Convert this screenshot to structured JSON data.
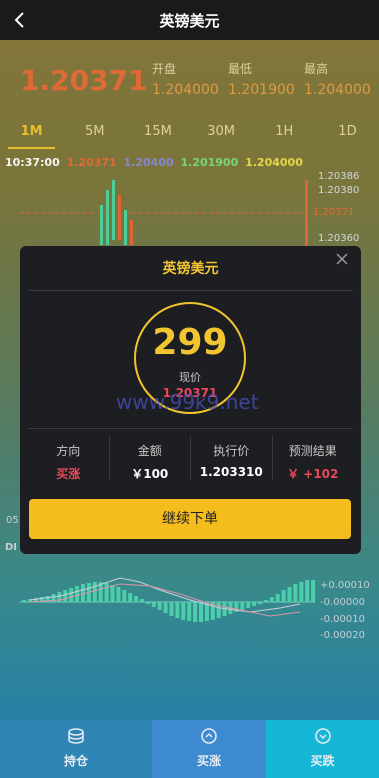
{
  "header": {
    "title": "英镑美元"
  },
  "quote": {
    "price": "1.20371",
    "stats": [
      {
        "label": "开盘",
        "value": "1.204000"
      },
      {
        "label": "最低",
        "value": "1.201900"
      },
      {
        "label": "最高",
        "value": "1.204000"
      }
    ]
  },
  "timeframes": [
    "1M",
    "5M",
    "15M",
    "30M",
    "1H",
    "1D"
  ],
  "active_timeframe": "1M",
  "ohlc_line": {
    "time": "10:37:00",
    "values": [
      "1.20371",
      "1.20400",
      "1.201900",
      "1.204000"
    ]
  },
  "price_axis": [
    "1.20386",
    "1.20380",
    "1.20371",
    "1.20360"
  ],
  "macd_axis": [
    "+0.00010",
    "-0.00000",
    "-0.00010",
    "-0.00020"
  ],
  "partial_labels": {
    "left_time": "05",
    "indicator": "DI"
  },
  "modal": {
    "title": "英镑美元",
    "countdown": "299",
    "current_label": "现价",
    "current_value": "1.20371",
    "watermark": "www.99k9.net",
    "info": [
      {
        "label": "方向",
        "value": "买涨"
      },
      {
        "label": "金额",
        "value": "￥100"
      },
      {
        "label": "执行价",
        "value": "1.203310"
      },
      {
        "label": "预测结果",
        "value": "￥ +102"
      }
    ],
    "submit_label": "继续下单"
  },
  "footer": [
    {
      "label": "持仓",
      "icon": "coins-icon"
    },
    {
      "label": "买涨",
      "icon": "up-coin-icon"
    },
    {
      "label": "买跌",
      "icon": "down-coin-icon"
    }
  ],
  "colors": {
    "accent": "#f2c530",
    "up": "#e8485a",
    "price_orange": "#e8703a",
    "button": "#f4bc1c",
    "footer_buy_up": "#3e8bd1",
    "footer_buy_down": "#16b6d6"
  }
}
